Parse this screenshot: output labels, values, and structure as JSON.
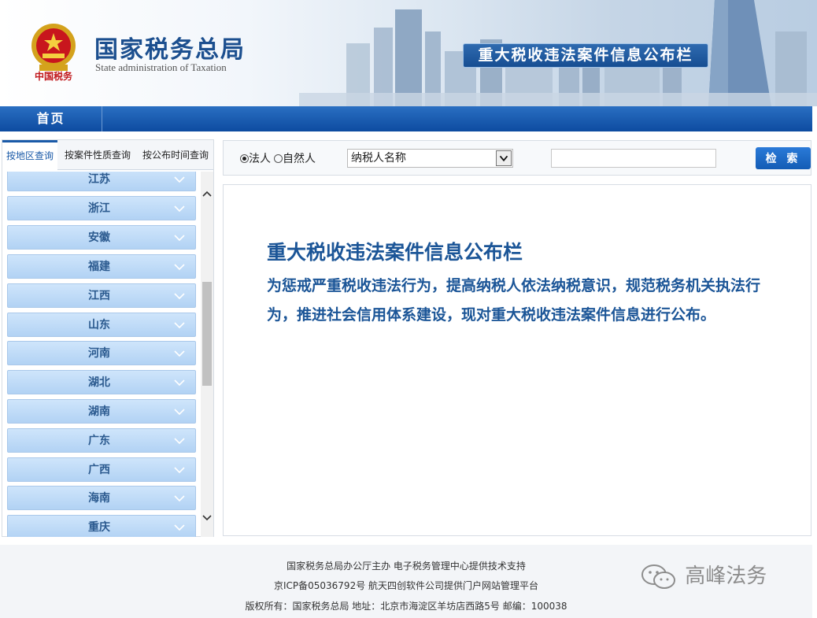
{
  "header": {
    "org_name_cn": "国家税务总局",
    "org_name_en": "State administration of Taxation",
    "motto": "中国税务",
    "board_title": "重大税收违法案件信息公布栏"
  },
  "nav": {
    "home": "首页"
  },
  "left_panel": {
    "tabs": [
      {
        "label": "按地区查询",
        "active": true
      },
      {
        "label": "按案件性质查询",
        "active": false
      },
      {
        "label": "按公布时间查询",
        "active": false
      }
    ],
    "provinces": [
      "江苏",
      "浙江",
      "安徽",
      "福建",
      "江西",
      "山东",
      "河南",
      "湖北",
      "湖南",
      "广东",
      "广西",
      "海南",
      "重庆"
    ]
  },
  "search": {
    "radio_legal": "法人",
    "radio_natural": "自然人",
    "selected_field": "纳税人名称",
    "input_value": "",
    "button_label": "检 索"
  },
  "content": {
    "title": "重大税收违法案件信息公布栏",
    "text": "为惩戒严重税收违法行为，提高纳税人依法纳税意识，规范税务机关执法行为，推进社会信用体系建设，现对重大税收违法案件信息进行公布。"
  },
  "footer": {
    "line1": "国家税务总局办公厅主办 电子税务管理中心提供技术支持",
    "line2": "京ICP备05036792号 航天四创软件公司提供门户网站管理平台",
    "line3": "版权所有：国家税务总局 地址：北京市海淀区羊坊店西路5号 邮编：100038",
    "watermark": "高峰法务"
  },
  "colors": {
    "brand_blue": "#1b5597",
    "nav_blue": "#0d4ba0",
    "province_bg": "#b2d2f4"
  }
}
